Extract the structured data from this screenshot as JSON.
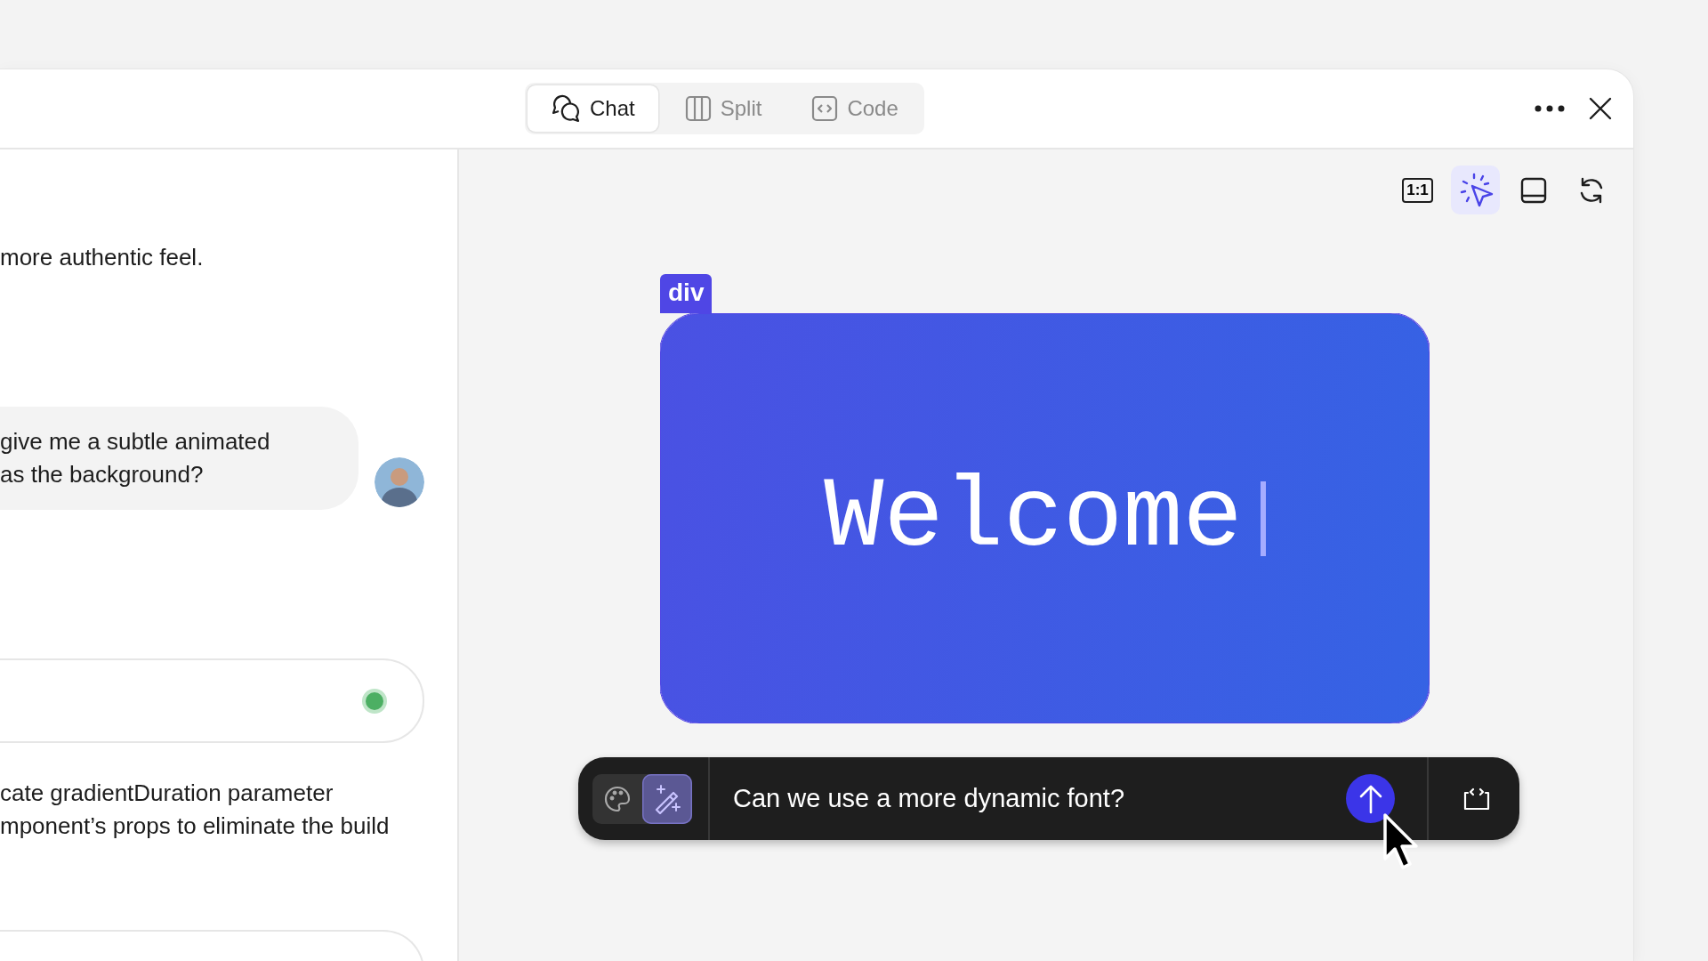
{
  "header": {
    "tabs": [
      {
        "label": "Chat",
        "kind": "chat",
        "selected": true
      },
      {
        "label": "Split",
        "kind": "split",
        "selected": false
      },
      {
        "label": "Code",
        "kind": "code",
        "selected": false
      }
    ]
  },
  "chat": {
    "messages": [
      {
        "kind": "assistant",
        "lines": [
          "more authentic feel."
        ]
      },
      {
        "kind": "user",
        "lines": [
          "give me a subtle animated",
          "as the background?"
        ]
      },
      {
        "kind": "status"
      },
      {
        "kind": "assistant",
        "lines": [
          "cate gradientDuration parameter",
          "mponent’s props to eliminate the build"
        ]
      },
      {
        "kind": "card"
      }
    ]
  },
  "toolbar": [
    {
      "kind": "ratio",
      "label": "1:1",
      "selected": false
    },
    {
      "kind": "select",
      "selected": true
    },
    {
      "kind": "panel",
      "selected": false
    },
    {
      "kind": "refresh",
      "selected": false
    }
  ],
  "preview": {
    "tag": "div",
    "text": "Welcome"
  },
  "prompt": {
    "modes": [
      {
        "kind": "style",
        "selected": false
      },
      {
        "kind": "edit",
        "selected": true
      }
    ],
    "value": "Can we use a more dynamic font?"
  }
}
